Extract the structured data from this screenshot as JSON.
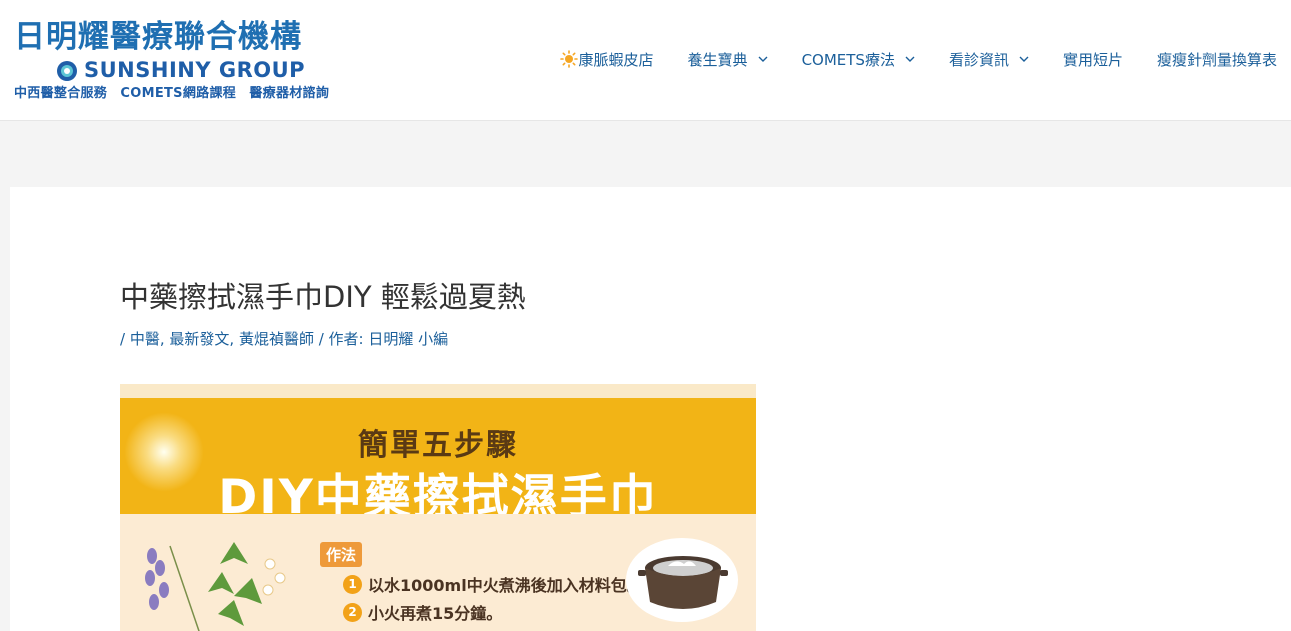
{
  "header": {
    "logo": {
      "title": "日明耀醫療聯合機構",
      "brand": "SUNSHINY GROUP",
      "subtitle": "中西醫整合服務　COMETS網路課程　醫療器材諮詢"
    },
    "nav": [
      {
        "label": "康脈蝦皮店",
        "icon": "sun-icon"
      },
      {
        "label": "養生寶典",
        "dropdown": true
      },
      {
        "label": "COMETS療法",
        "dropdown": true
      },
      {
        "label": "看診資訊",
        "dropdown": true
      },
      {
        "label": "實用短片"
      },
      {
        "label": "瘦瘦針劑量換算表"
      }
    ]
  },
  "post": {
    "title": "中藥擦拭濕手巾DIY 輕鬆過夏熱",
    "meta": {
      "prefix": "/ ",
      "categories": [
        "中醫",
        "最新發文",
        "黃焜禎醫師"
      ],
      "author_prefix": " / 作者: ",
      "author": "日明耀 小編"
    },
    "featured_image": {
      "subtitle": "簡單五步驟",
      "headline": "DIY中藥擦拭濕手巾",
      "method_label": "作法",
      "steps": [
        {
          "num": "1",
          "text": "以水1000ml中火煮沸後加入材料包。"
        },
        {
          "num": "2",
          "text": "小火再煮15分鐘。"
        }
      ]
    }
  },
  "colors": {
    "accent": "#1b5f9a",
    "banner": "#f2b416",
    "background": "#f4f4f4"
  }
}
